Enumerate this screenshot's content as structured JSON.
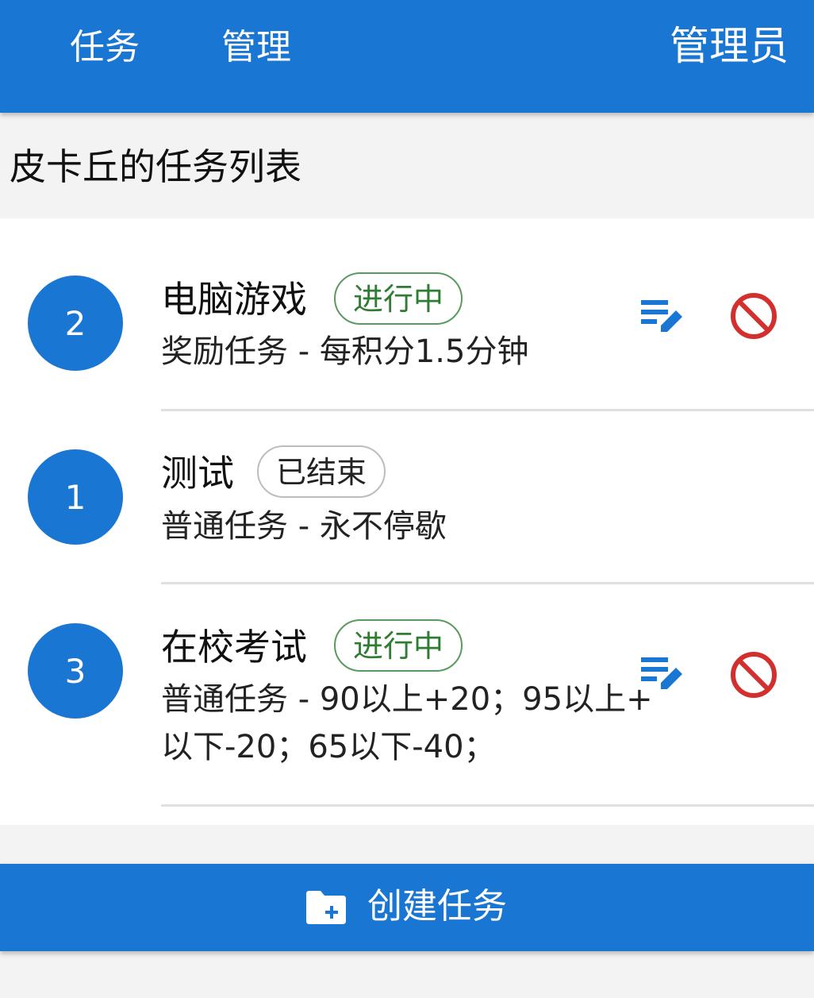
{
  "nav": {
    "task": "任务",
    "manage": "管理",
    "admin": "管理员"
  },
  "page_title": "皮卡丘的任务列表",
  "tasks": [
    {
      "number": "2",
      "name": "电脑游戏",
      "status": "进行中",
      "description": "奖励任务 - 每积分1.5分钟"
    },
    {
      "number": "1",
      "name": "测试",
      "status": "已结束",
      "description": "普通任务 - 永不停歇"
    },
    {
      "number": "3",
      "name": "在校考试",
      "status": "进行中",
      "description_line1": "普通任务 - 90以上+20；95以上+",
      "description_line2": "以下-20；65以下-40；"
    }
  ],
  "create_button": {
    "label": "创建任务"
  },
  "icons": {
    "edit": "edit-list-icon",
    "cancel": "block-icon",
    "create": "folder-plus-icon"
  },
  "colors": {
    "primary": "#1976d2",
    "running": "#2e7d32",
    "cancel": "#d32f2f"
  }
}
